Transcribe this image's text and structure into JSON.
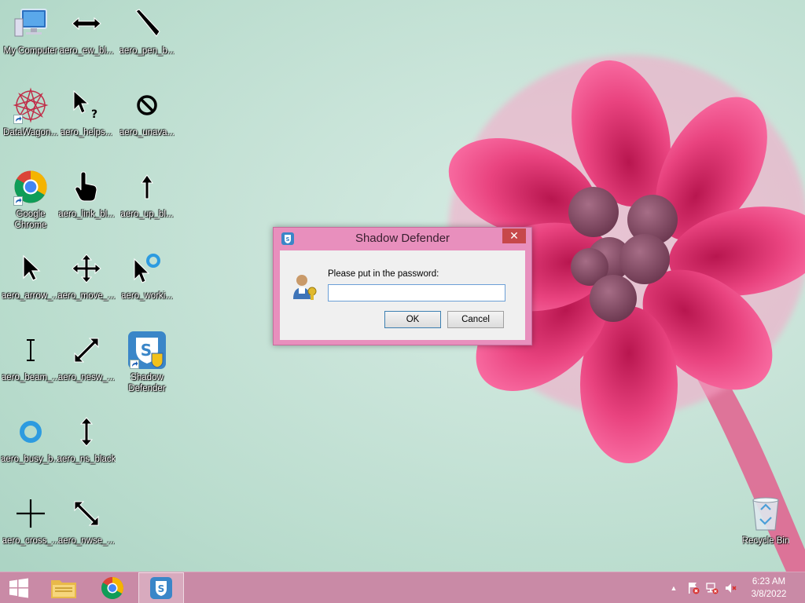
{
  "desktop": {
    "icons": [
      {
        "label": "My Computer",
        "icon": "computer-icon"
      },
      {
        "label": "aero_ew_bl...",
        "icon": "resize-ew-cursor-icon"
      },
      {
        "label": "aero_pen_b...",
        "icon": "pen-cursor-icon"
      },
      {
        "label": "DataWagon...",
        "icon": "datawagon-icon"
      },
      {
        "label": "aero_helps...",
        "icon": "help-select-cursor-icon"
      },
      {
        "label": "aero_unava...",
        "icon": "unavailable-cursor-icon"
      },
      {
        "label": "Google Chrome",
        "icon": "chrome-icon"
      },
      {
        "label": "aero_link_bl...",
        "icon": "link-hand-cursor-icon"
      },
      {
        "label": "aero_up_bl...",
        "icon": "up-arrow-cursor-icon"
      },
      {
        "label": "aero_arrow_...",
        "icon": "arrow-cursor-icon"
      },
      {
        "label": "aero_move_...",
        "icon": "move-cursor-icon"
      },
      {
        "label": "aero_worki...",
        "icon": "working-cursor-icon"
      },
      {
        "label": "aero_beam_...",
        "icon": "text-beam-cursor-icon"
      },
      {
        "label": "aero_nesw_...",
        "icon": "resize-nesw-cursor-icon"
      },
      {
        "label": "Shadow Defender",
        "icon": "shadow-defender-icon"
      },
      {
        "label": "aero_busy_b...",
        "icon": "busy-cursor-icon"
      },
      {
        "label": "aero_ns_black",
        "icon": "resize-ns-cursor-icon"
      },
      {
        "label": "aero_cross_...",
        "icon": "crosshair-cursor-icon"
      },
      {
        "label": "aero_nwse_...",
        "icon": "resize-nwse-cursor-icon"
      },
      {
        "label": "Recycle Bin",
        "icon": "recycle-bin-icon"
      }
    ]
  },
  "dialog": {
    "title": "Shadow Defender",
    "close": "✕",
    "prompt": "Please put in the password:",
    "password_value": "",
    "ok_label": "OK",
    "cancel_label": "Cancel"
  },
  "taskbar": {
    "clock_time": "6:23 AM",
    "clock_date": "3/8/2022",
    "tray_expand": "▲"
  },
  "colors": {
    "taskbar": "#c98aa6",
    "dialog_frame": "#e88fbd",
    "close_button": "#c7484a",
    "accent_blue": "#3c7fb1"
  }
}
